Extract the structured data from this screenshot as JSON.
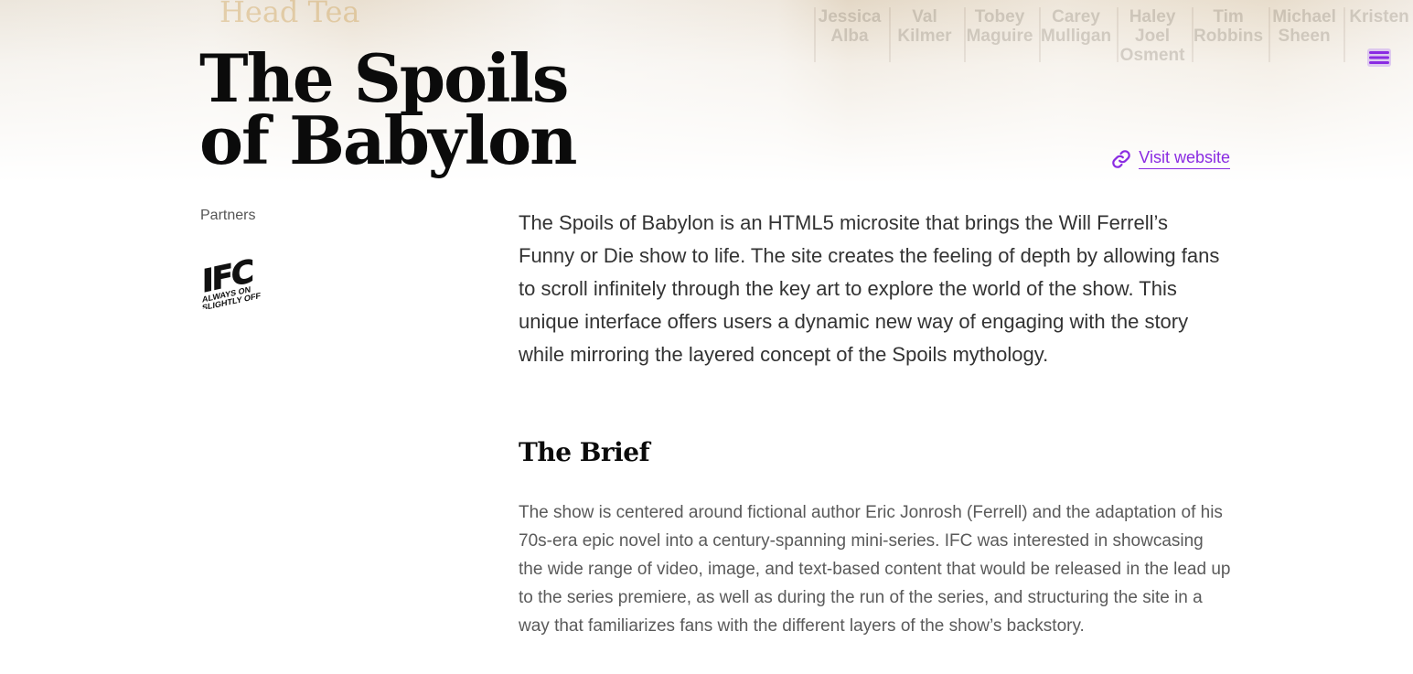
{
  "page": {
    "title": "The Spoils of Babylon",
    "visit_label": "Visit website",
    "partners_label": "Partners",
    "accent_color": "#8a2be2"
  },
  "hero": {
    "background_text": "Head Tea",
    "cast_names": [
      "Jessica Alba",
      "Val Kilmer",
      "Tobey Maguire",
      "Carey Mulligan",
      "Haley Joel Osment",
      "Tim Robbins",
      "Michael Sheen",
      "Kristen"
    ]
  },
  "partner": {
    "name": "IFC",
    "tagline": "ALWAYS ON SLIGHTLY OFF"
  },
  "intro": "The Spoils of Babylon is an HTML5 microsite that brings the Will Ferrell’s Funny or Die show to life. The site creates the feeling of depth by allowing fans to scroll infinitely through the key art to explore the world of the show. This unique interface offers users a dynamic new way of engaging with the story while mirroring the layered concept of the Spoils mythology.",
  "brief": {
    "title": "The Brief",
    "text": "The show is centered around fictional author Eric Jonrosh (Ferrell) and the adaptation of his 70s-era epic novel into a century-spanning mini-series. IFC was interested in showcasing the wide range of video, image, and text-based content that would be released in the lead up to the series premiere, as well as during the run of the series, and structuring the site in a way that familiarizes fans with the different layers of the show’s backstory."
  },
  "icons": {
    "menu": "hamburger-menu-icon",
    "link": "link-icon"
  }
}
